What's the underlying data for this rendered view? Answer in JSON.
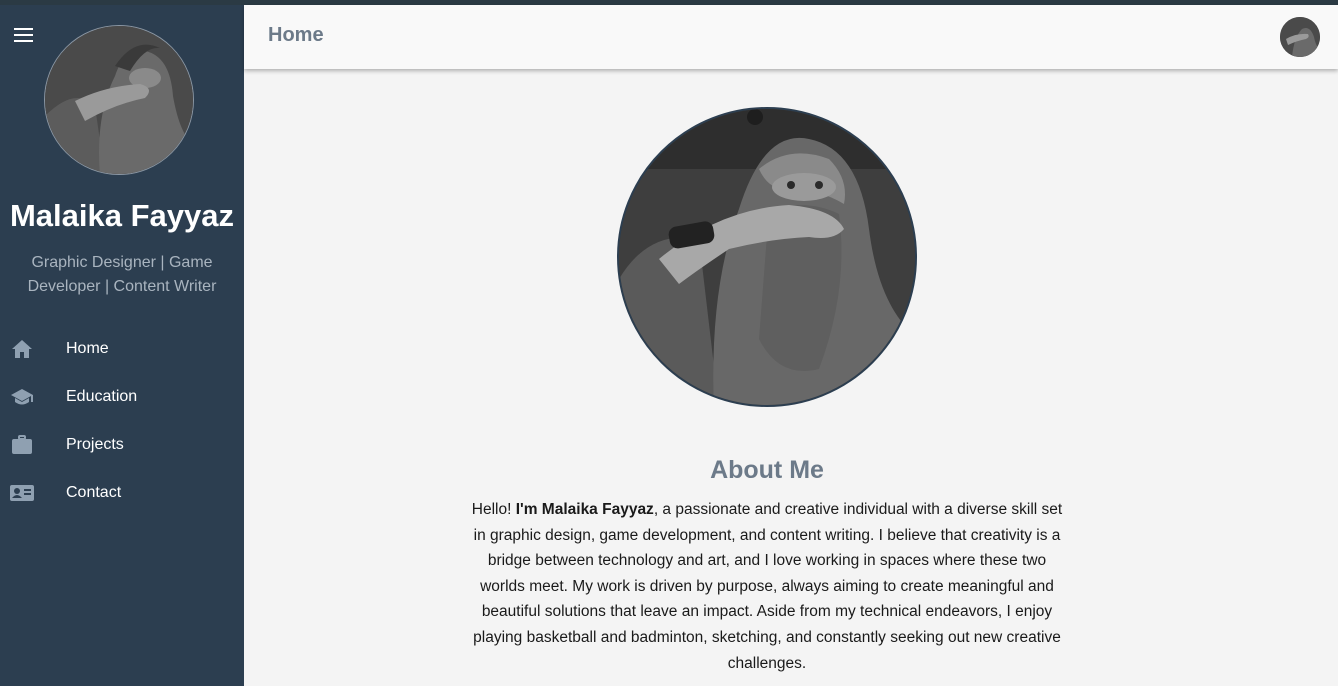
{
  "sidebar": {
    "name": "Malaika Fayyaz",
    "role": "Graphic Designer | Game Developer | Content Writer",
    "items": [
      {
        "label": "Home",
        "icon": "home-icon"
      },
      {
        "label": "Education",
        "icon": "graduation-cap-icon"
      },
      {
        "label": "Projects",
        "icon": "briefcase-icon"
      },
      {
        "label": "Contact",
        "icon": "contact-card-icon"
      }
    ]
  },
  "header": {
    "title": "Home"
  },
  "about": {
    "title": "About Me",
    "intro": "Hello! ",
    "name_bold": "I'm Malaika Fayyaz",
    "body": ", a passionate and creative individual with a diverse skill set in graphic design, game development, and content writing. I believe that creativity is a bridge between technology and art, and I love working in spaces where these two worlds meet. My work is driven by purpose, always aiming to create meaningful and beautiful solutions that leave an impact. Aside from my technical endeavors, I enjoy playing basketball and badminton, sketching, and constantly seeking out new creative challenges."
  },
  "colors": {
    "sidebar_bg": "#2c3e50",
    "accent_text": "#6c7a89",
    "page_bg": "#f4f4f4"
  }
}
